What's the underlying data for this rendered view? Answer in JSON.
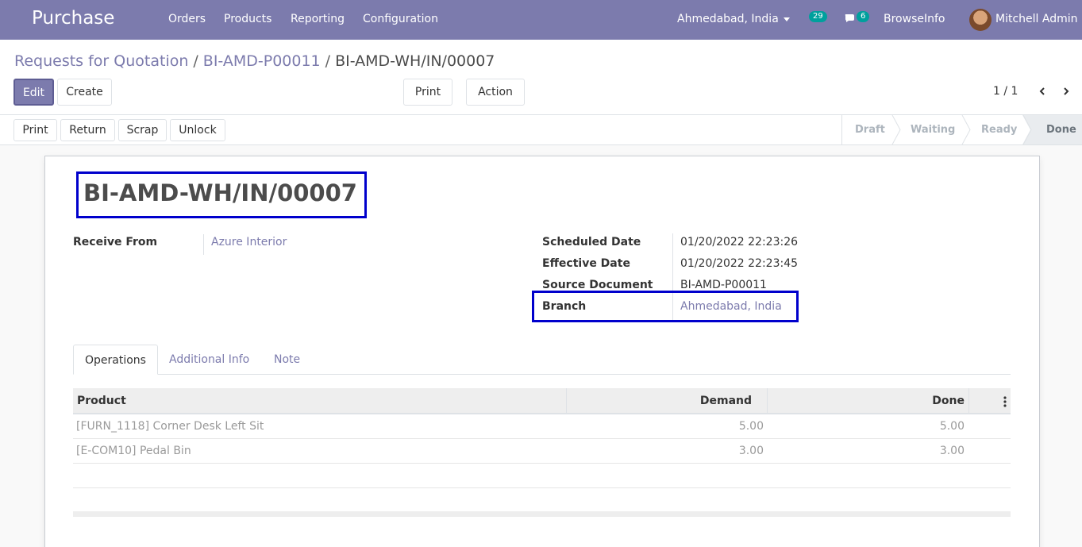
{
  "navbar": {
    "app_name": "Purchase",
    "menus": [
      "Orders",
      "Products",
      "Reporting",
      "Configuration"
    ],
    "branch_selector": "Ahmedabad, India",
    "activity_count": "29",
    "message_count": "6",
    "company": "BrowseInfo",
    "user": "Mitchell Admin"
  },
  "breadcrumb": {
    "items": [
      "Requests for Quotation",
      "BI-AMD-P00011",
      "BI-AMD-WH/IN/00007"
    ],
    "separator": "/"
  },
  "toolbar": {
    "edit_label": "Edit",
    "create_label": "Create",
    "print_label": "Print",
    "action_label": "Action",
    "pager": "1 / 1"
  },
  "statusbar": {
    "buttons": [
      "Print",
      "Return",
      "Scrap",
      "Unlock"
    ],
    "stages": [
      "Draft",
      "Waiting",
      "Ready",
      "Done"
    ],
    "active_stage": "Done"
  },
  "record": {
    "title": "BI-AMD-WH/IN/00007",
    "receive_from_label": "Receive From",
    "receive_from_value": "Azure Interior",
    "scheduled_date_label": "Scheduled Date",
    "scheduled_date_value": "01/20/2022 22:23:26",
    "effective_date_label": "Effective Date",
    "effective_date_value": "01/20/2022 22:23:45",
    "source_document_label": "Source Document",
    "source_document_value": "BI-AMD-P00011",
    "branch_label": "Branch",
    "branch_value": "Ahmedabad, India"
  },
  "tabs": [
    "Operations",
    "Additional Info",
    "Note"
  ],
  "operations": {
    "columns": [
      "Product",
      "Demand",
      "Done"
    ],
    "rows": [
      {
        "product": "[FURN_1118] Corner Desk Left Sit",
        "demand": "5.00",
        "done": "5.00"
      },
      {
        "product": "[E-COM10] Pedal Bin",
        "demand": "3.00",
        "done": "3.00"
      }
    ]
  },
  "colors": {
    "brand": "#7c7bad",
    "highlight_box": "#0000cc",
    "badge": "#00a09d"
  }
}
